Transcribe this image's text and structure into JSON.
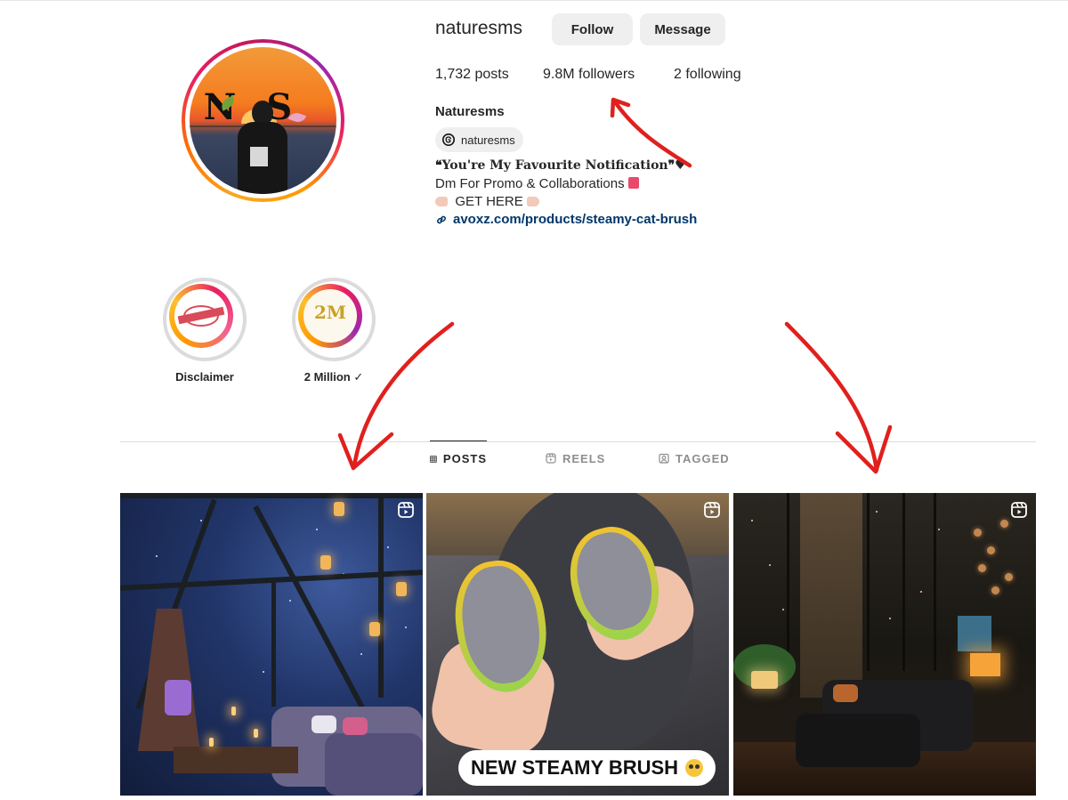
{
  "profile": {
    "username": "naturesms",
    "follow_label": "Follow",
    "message_label": "Message",
    "stats": {
      "posts": "1,732 posts",
      "followers": "9.8M followers",
      "following": "2 following"
    },
    "full_name": "Naturesms",
    "threads_handle": "naturesms",
    "bio": {
      "line1": "❝You're My Favourite Notification❞♥",
      "line2": "Dm For Promo & Collaborations",
      "line3": "GET HERE",
      "link": "avoxz.com/products/steamy-cat-brush"
    }
  },
  "highlights": [
    {
      "label": "Disclaimer",
      "icon": "disclaimer-stamp-icon"
    },
    {
      "label": "2 Million ✓",
      "icon": "2m-gold-icon"
    }
  ],
  "tabs": [
    {
      "label": "POSTS",
      "icon": "grid-icon",
      "active": true
    },
    {
      "label": "REELS",
      "icon": "reels-icon",
      "active": false
    },
    {
      "label": "TAGGED",
      "icon": "tagged-icon",
      "active": false
    }
  ],
  "posts": [
    {
      "type": "reel",
      "scene": "glass-cabin-night"
    },
    {
      "type": "reel",
      "scene": "cat-brush",
      "caption": "NEW STEAMY BRUSH"
    },
    {
      "type": "reel",
      "scene": "modern-living-room"
    }
  ],
  "colors": {
    "button_bg": "#efefef",
    "link": "#00376b",
    "annotation_arrow": "#e0201d",
    "story_ring_start": "#f9a825",
    "story_ring_end": "#c2185b"
  }
}
